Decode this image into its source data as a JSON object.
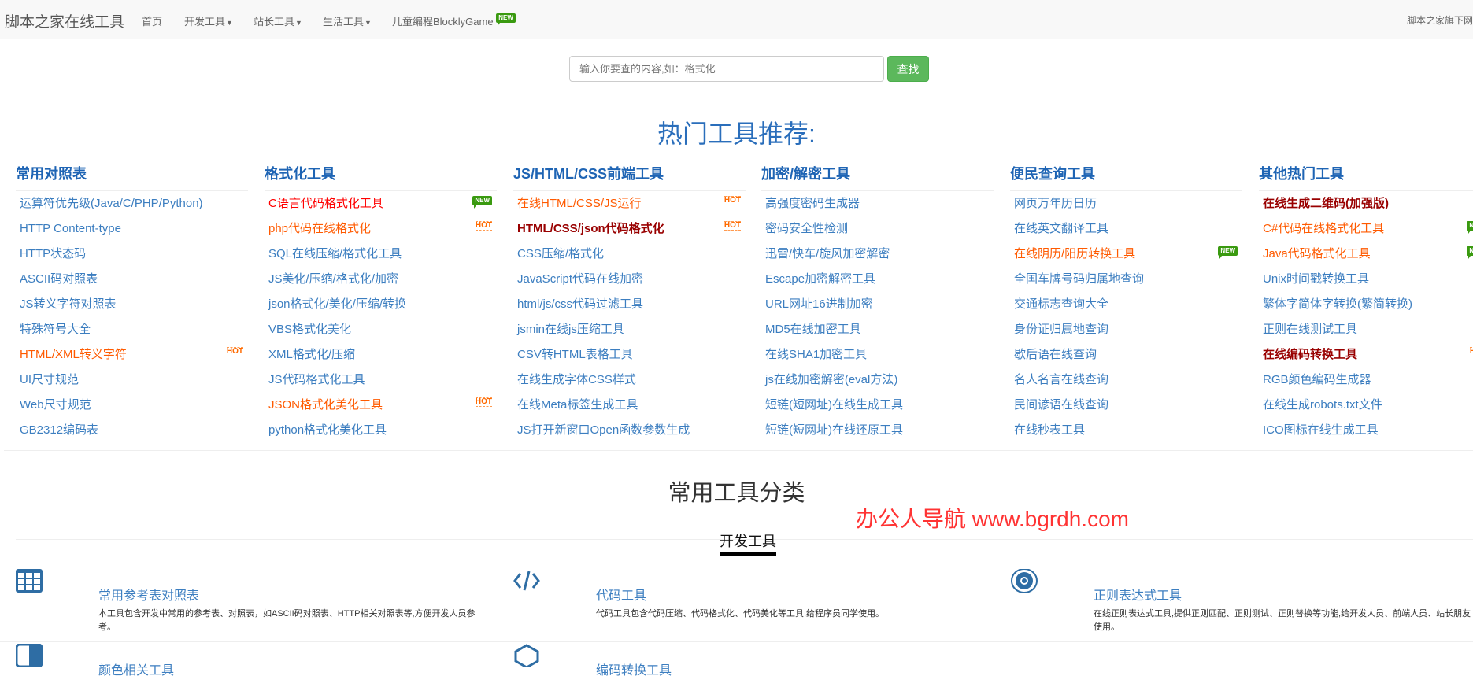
{
  "nav": {
    "brand": "脚本之家在线工具",
    "items": [
      {
        "label": "首页",
        "caret": false
      },
      {
        "label": "开发工具",
        "caret": true
      },
      {
        "label": "站长工具",
        "caret": true
      },
      {
        "label": "生活工具",
        "caret": true
      },
      {
        "label": "儿童编程BlocklyGame",
        "caret": false,
        "badge": "NEW"
      }
    ],
    "right": "脚本之家旗下网"
  },
  "search": {
    "placeholder": "输入你要查的内容,如：格式化",
    "button": "查找"
  },
  "hot_title": "热门工具推荐:",
  "badges": {
    "new": "NEW",
    "hot": "HOT"
  },
  "columns": [
    {
      "title": "常用对照表",
      "items": [
        {
          "text": "运算符优先级(Java/C/PHP/Python)"
        },
        {
          "text": "HTTP Content-type"
        },
        {
          "text": "HTTP状态码"
        },
        {
          "text": "ASCII码对照表"
        },
        {
          "text": "JS转义字符对照表"
        },
        {
          "text": "特殊符号大全"
        },
        {
          "text": "HTML/XML转义字符",
          "style": "orange",
          "badge": "hot"
        },
        {
          "text": "UI尺寸规范"
        },
        {
          "text": "Web尺寸规范"
        },
        {
          "text": "GB2312编码表"
        }
      ]
    },
    {
      "title": "格式化工具",
      "items": [
        {
          "text": "C语言代码格式化工具",
          "style": "red",
          "badge": "new"
        },
        {
          "text": "php代码在线格式化",
          "style": "orange",
          "badge": "hot"
        },
        {
          "text": "SQL在线压缩/格式化工具"
        },
        {
          "text": "JS美化/压缩/格式化/加密"
        },
        {
          "text": "json格式化/美化/压缩/转换"
        },
        {
          "text": "VBS格式化美化"
        },
        {
          "text": "XML格式化/压缩"
        },
        {
          "text": "JS代码格式化工具"
        },
        {
          "text": "JSON格式化美化工具",
          "style": "orange",
          "badge": "hot"
        },
        {
          "text": "python格式化美化工具"
        }
      ]
    },
    {
      "title": "JS/HTML/CSS前端工具",
      "items": [
        {
          "text": "在线HTML/CSS/JS运行",
          "style": "orange",
          "badge": "hot"
        },
        {
          "text": "HTML/CSS/json代码格式化",
          "style": "darkred",
          "badge": "hot"
        },
        {
          "text": "CSS压缩/格式化"
        },
        {
          "text": "JavaScript代码在线加密"
        },
        {
          "text": "html/js/css代码过滤工具"
        },
        {
          "text": "jsmin在线js压缩工具"
        },
        {
          "text": "CSV转HTML表格工具"
        },
        {
          "text": "在线生成字体CSS样式"
        },
        {
          "text": "在线Meta标签生成工具"
        },
        {
          "text": "JS打开新窗口Open函数参数生成"
        }
      ]
    },
    {
      "title": "加密/解密工具",
      "items": [
        {
          "text": "高强度密码生成器"
        },
        {
          "text": "密码安全性检测"
        },
        {
          "text": "迅雷/快车/旋风加密解密"
        },
        {
          "text": "Escape加密解密工具"
        },
        {
          "text": "URL网址16进制加密"
        },
        {
          "text": "MD5在线加密工具"
        },
        {
          "text": "在线SHA1加密工具"
        },
        {
          "text": "js在线加密解密(eval方法)"
        },
        {
          "text": "短链(短网址)在线生成工具"
        },
        {
          "text": "短链(短网址)在线还原工具"
        }
      ]
    },
    {
      "title": "便民查询工具",
      "items": [
        {
          "text": "网页万年历日历"
        },
        {
          "text": "在线英文翻译工具"
        },
        {
          "text": "在线阴历/阳历转换工具",
          "style": "orange",
          "badge": "new"
        },
        {
          "text": "全国车牌号码归属地查询"
        },
        {
          "text": "交通标志查询大全"
        },
        {
          "text": "身份证归属地查询"
        },
        {
          "text": "歇后语在线查询"
        },
        {
          "text": "名人名言在线查询"
        },
        {
          "text": "民间谚语在线查询"
        },
        {
          "text": "在线秒表工具"
        }
      ]
    },
    {
      "title": "其他热门工具",
      "items": [
        {
          "text": "在线生成二维码(加强版)",
          "style": "darkred"
        },
        {
          "text": "C#代码在线格式化工具",
          "style": "orange",
          "badge": "new"
        },
        {
          "text": "Java代码格式化工具",
          "style": "orange",
          "badge": "new"
        },
        {
          "text": "Unix时间戳转换工具"
        },
        {
          "text": "繁体字简体字转换(繁简转换)"
        },
        {
          "text": "正则在线测试工具"
        },
        {
          "text": "在线编码转换工具",
          "style": "darkred",
          "badge": "hot"
        },
        {
          "text": "RGB颜色编码生成器"
        },
        {
          "text": "在线生成robots.txt文件"
        },
        {
          "text": "ICO图标在线生成工具"
        }
      ]
    }
  ],
  "category_title": "常用工具分类",
  "watermark": "办公人导航 www.bgrdh.com",
  "active_tab": "开发工具",
  "cards": [
    {
      "icon": "table-icon",
      "title": "常用参考表对照表",
      "desc": "本工具包含开发中常用的参考表、对照表，如ASCII码对照表、HTTP相关对照表等,方便开发人员参考。"
    },
    {
      "icon": "code-icon",
      "title": "代码工具",
      "desc": "代码工具包含代码压缩、代码格式化、代码美化等工具,给程序员同学使用。"
    },
    {
      "icon": "regex-emblem-icon",
      "title": "正则表达式工具",
      "desc": "在线正则表达式工具,提供正则匹配、正则测试、正则替换等功能,给开发人员、前端人员、站长朋友使用。"
    },
    {
      "icon": "color-icon",
      "title": "颜色相关工具"
    },
    {
      "icon": "encoding-icon",
      "title": "编码转换工具"
    }
  ],
  "colors": {
    "link": "#3c7ec0",
    "heading": "#1e64b4",
    "orange": "#ff5a00",
    "red": "#ff0000",
    "darkred": "#990000",
    "button": "#5cb85c",
    "new_badge": "#3a9a10"
  }
}
